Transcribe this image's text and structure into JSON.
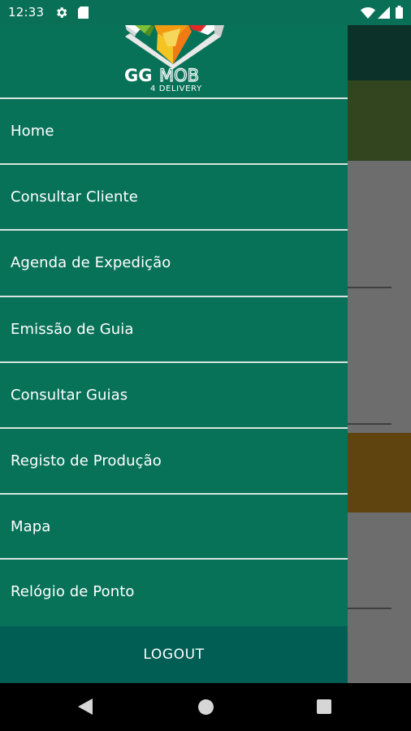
{
  "status_bar": {
    "time": "12:33"
  },
  "logo": {
    "brand_gg": "GG",
    "brand_mob": "MOB",
    "tagline": "4 DELIVERY"
  },
  "menu": {
    "items": [
      {
        "label": "Home"
      },
      {
        "label": "Consultar Cliente"
      },
      {
        "label": "Agenda de Expedição"
      },
      {
        "label": "Emissão de Guia"
      },
      {
        "label": "Consultar Guias"
      },
      {
        "label": "Registo de Produção"
      },
      {
        "label": "Mapa"
      },
      {
        "label": "Relógio de Ponto"
      }
    ],
    "logout_label": "LOGOUT"
  },
  "colors": {
    "status_bar": "#0a6f57",
    "drawer": "#087259",
    "logout_bar": "#005e55",
    "text": "#ffffff"
  }
}
